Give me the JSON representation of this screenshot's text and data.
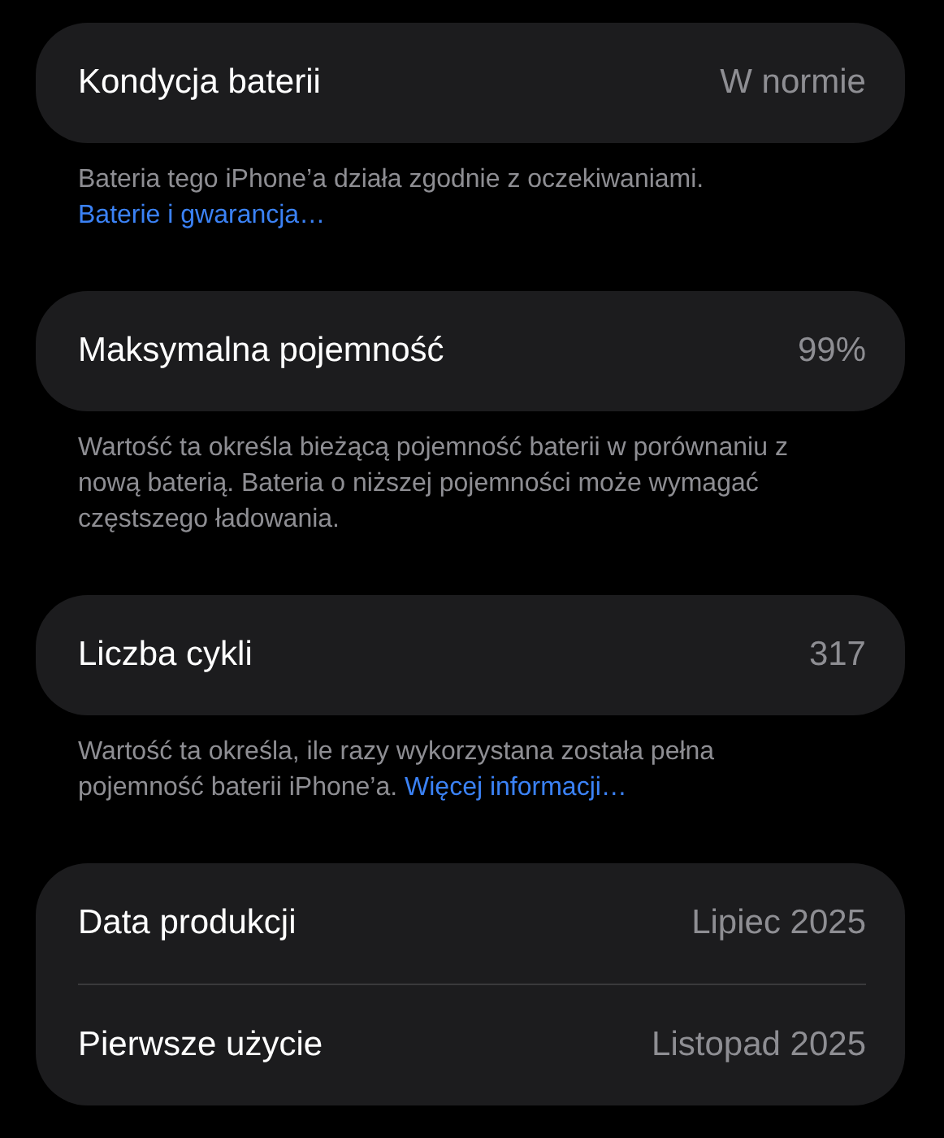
{
  "sections": [
    {
      "rows": [
        {
          "label": "Kondycja baterii",
          "value": "W normie"
        }
      ],
      "footer": {
        "text": "Bateria tego iPhone’a działa zgodnie z oczekiwaniami.",
        "link": "Baterie i gwarancja…"
      }
    },
    {
      "rows": [
        {
          "label": "Maksymalna pojemność",
          "value": "99%"
        }
      ],
      "footer": {
        "text": "Wartość ta określa bieżącą pojemność baterii w porównaniu z nową baterią. Bateria o niższej pojemności może wymagać częstszego ładowania."
      }
    },
    {
      "rows": [
        {
          "label": "Liczba cykli",
          "value": "317"
        }
      ],
      "footer": {
        "text": "Wartość ta określa, ile razy wykorzystana została pełna pojemność baterii iPhone’a.",
        "link": "Więcej informacji…"
      }
    },
    {
      "rows": [
        {
          "label": "Data produkcji",
          "value": "Lipiec 2025"
        },
        {
          "label": "Pierwsze użycie",
          "value": "Listopad 2025"
        }
      ]
    }
  ]
}
